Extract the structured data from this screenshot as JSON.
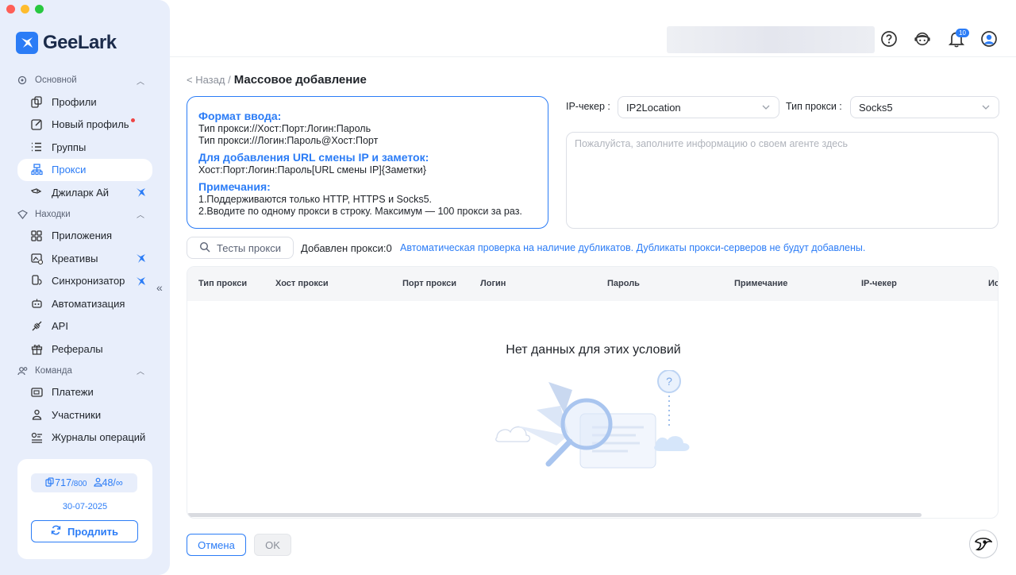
{
  "window": {
    "traffic_colors": [
      "#ff5f57",
      "#febc2e",
      "#28c840"
    ]
  },
  "brand": {
    "name": "GeeLark",
    "accent": "#2b7cf6"
  },
  "sidebar": {
    "sections": [
      {
        "label": "Основной",
        "items": [
          {
            "label": "Профили",
            "icon": "profiles-icon"
          },
          {
            "label": "Новый профиль",
            "icon": "edit-icon"
          },
          {
            "label": "Группы",
            "icon": "list-icon"
          },
          {
            "label": "Прокси",
            "icon": "proxy-icon",
            "active": true
          },
          {
            "label": "Джиларк Ай",
            "icon": "ai-icon"
          }
        ]
      },
      {
        "label": "Находки",
        "items": [
          {
            "label": "Приложения",
            "icon": "apps-icon"
          },
          {
            "label": "Креативы",
            "icon": "creatives-icon"
          },
          {
            "label": "Синхронизатор",
            "icon": "sync-icon"
          },
          {
            "label": "Автоматизация",
            "icon": "robot-icon"
          },
          {
            "label": "API",
            "icon": "api-icon"
          },
          {
            "label": "Рефералы",
            "icon": "gift-icon"
          }
        ]
      },
      {
        "label": "Команда",
        "items": [
          {
            "label": "Платежи",
            "icon": "payments-icon"
          },
          {
            "label": "Участники",
            "icon": "user-icon"
          },
          {
            "label": "Журналы операций",
            "icon": "logs-icon"
          }
        ]
      }
    ],
    "plan": {
      "profiles_used": "717",
      "profiles_total": "/800",
      "members": "48/",
      "members_inf": "∞",
      "date": "30-07-2025",
      "renew_label": "Продлить"
    }
  },
  "topbar": {
    "notifications_count": "10"
  },
  "page": {
    "back_label": "< Назад /",
    "title": "Массовое добавление",
    "format": {
      "heading1": "Формат ввода:",
      "line1": "Тип прокси://Хост:Порт:Логин:Пароль",
      "line2": "Тип прокси://Логин:Пароль@Хост:Порт",
      "heading2": "Для добавления URL смены IP и заметок:",
      "line3": "Хост:Порт:Логин:Пароль[URL смены IP]{Заметки}",
      "heading3": "Примечания:",
      "note1": "1.Поддерживаются только HTTP, HTTPS и Socks5.",
      "note2": "2.Вводите по одному прокси в строку. Максимум — 100 прокси за раз."
    },
    "ip_checker": {
      "label": "IP-чекер :",
      "value": "IP2Location"
    },
    "proxy_type": {
      "label": "Тип прокси :",
      "value": "Socks5"
    },
    "textarea_placeholder": "Пожалуйста, заполните информацию о своем агенте здесь",
    "test_button": "Тесты прокси",
    "added_label": "Добавлен прокси:0",
    "duplicate_note": "Автоматическая проверка на наличие дубликатов. Дубликаты прокси-серверов не будут добавлены.",
    "table": {
      "columns": [
        "Тип прокси",
        "Хост прокси",
        "Порт прокси",
        "Логин",
        "Пароль",
        "Примечание",
        "IP-чекер",
        "Ис"
      ],
      "empty_text": "Нет данных для этих условий"
    },
    "cancel_label": "Отмена",
    "ok_label": "OK"
  }
}
